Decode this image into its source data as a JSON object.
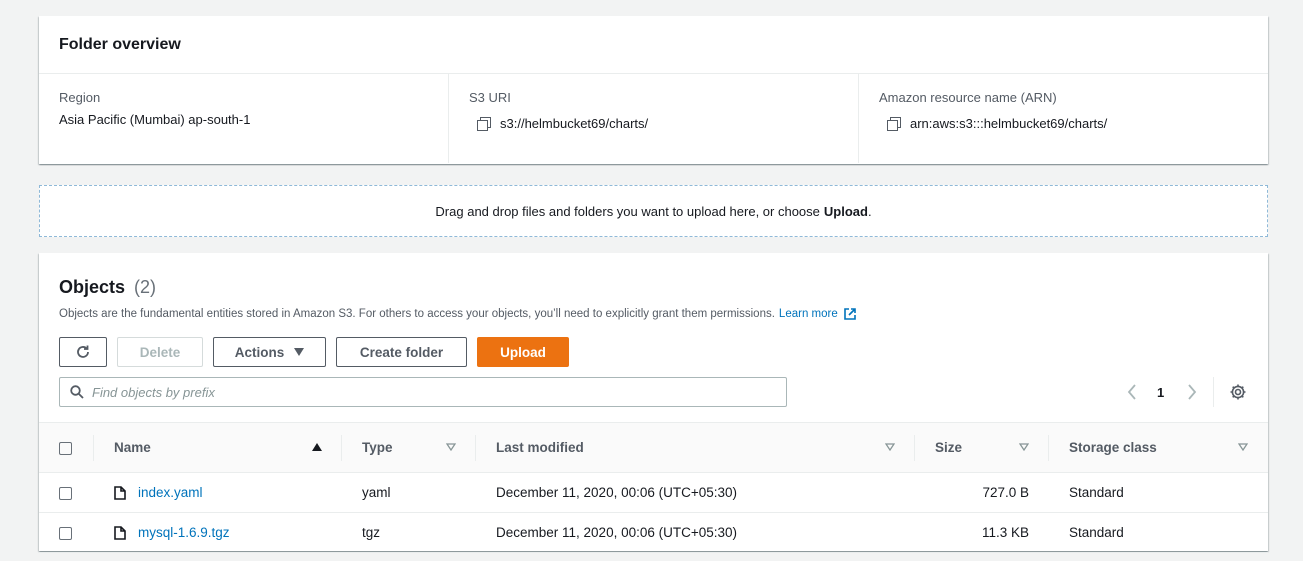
{
  "overview": {
    "title": "Folder overview",
    "region_label": "Region",
    "region_value": "Asia Pacific (Mumbai) ap-south-1",
    "uri_label": "S3 URI",
    "uri_value": "s3://helmbucket69/charts/",
    "arn_label": "Amazon resource name (ARN)",
    "arn_value": "arn:aws:s3:::helmbucket69/charts/"
  },
  "dropzone": {
    "text": "Drag and drop files and folders you want to upload here, or choose",
    "bold": "Upload",
    "end": "."
  },
  "objects": {
    "title": "Objects",
    "count": "(2)",
    "description": "Objects are the fundamental entities stored in Amazon S3. For others to access your objects, you’ll need to explicitly grant them permissions.",
    "learn_more": "Learn more",
    "buttons": {
      "delete": "Delete",
      "actions": "Actions",
      "create_folder": "Create folder",
      "upload": "Upload"
    },
    "search_placeholder": "Find objects by prefix",
    "page": "1",
    "columns": {
      "name": "Name",
      "type": "Type",
      "last_modified": "Last modified",
      "size": "Size",
      "storage_class": "Storage class"
    },
    "rows": [
      {
        "name": "index.yaml",
        "type": "yaml",
        "last_modified": "December 11, 2020, 00:06 (UTC+05:30)",
        "size": "727.0 B",
        "storage_class": "Standard"
      },
      {
        "name": "mysql-1.6.9.tgz",
        "type": "tgz",
        "last_modified": "December 11, 2020, 00:06 (UTC+05:30)",
        "size": "11.3 KB",
        "storage_class": "Standard"
      }
    ]
  },
  "colors": {
    "accent": "#ec7211",
    "link": "#0073bb"
  }
}
